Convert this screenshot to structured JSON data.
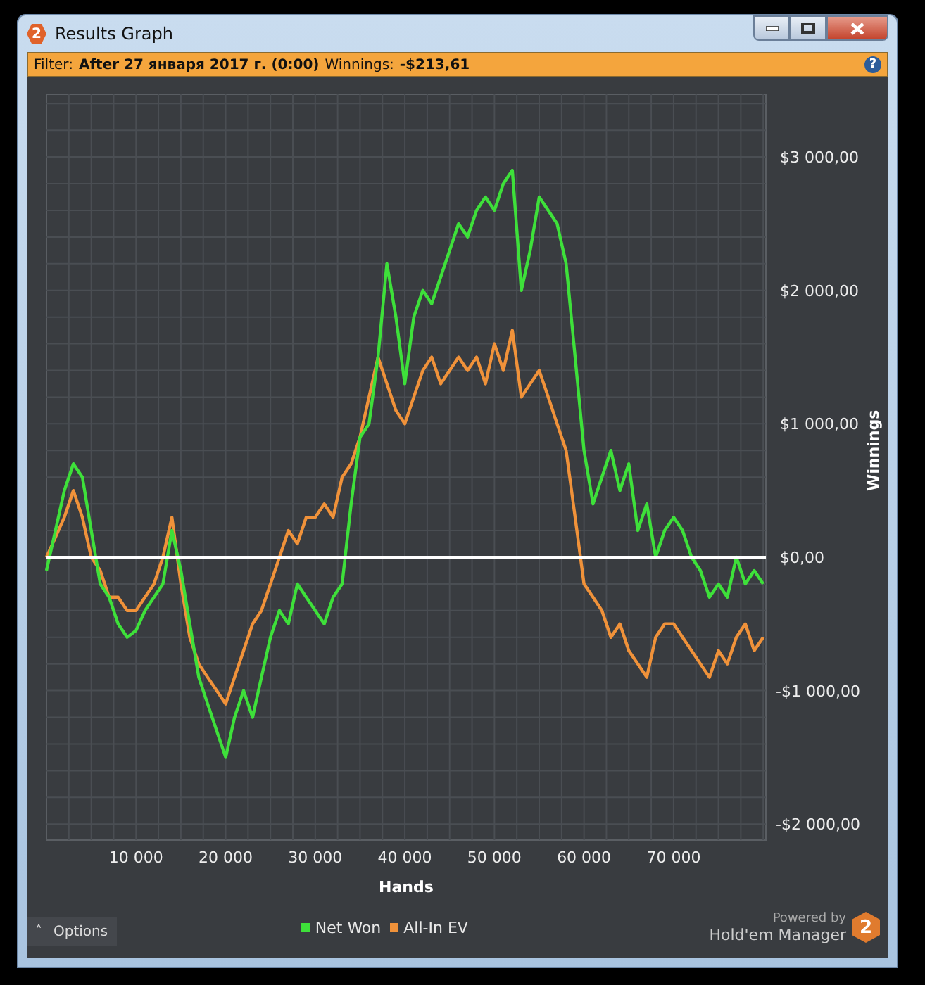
{
  "window": {
    "title": "Results Graph",
    "logo": "2"
  },
  "filter_bar": {
    "filter_label": "Filter:",
    "filter_value": "After 27 января 2017 г. (0:00)",
    "winnings_label": "Winnings:",
    "winnings_value": "-$213,61",
    "help": "?"
  },
  "chart": {
    "chart_data": {
      "type": "line",
      "grid": true,
      "xlabel": "Hands",
      "ylabel": "Winnings",
      "xlim": [
        0,
        80300
      ],
      "ylim": [
        -2120,
        3470
      ],
      "xticks": [
        {
          "value": 10000,
          "label": "10 000"
        },
        {
          "value": 20000,
          "label": "20 000"
        },
        {
          "value": 30000,
          "label": "30 000"
        },
        {
          "value": 40000,
          "label": "40 000"
        },
        {
          "value": 50000,
          "label": "50 000"
        },
        {
          "value": 60000,
          "label": "60 000"
        },
        {
          "value": 70000,
          "label": "70 000"
        }
      ],
      "yticks": [
        {
          "value": 3000,
          "label": "$3 000,00"
        },
        {
          "value": 2000,
          "label": "$2 000,00"
        },
        {
          "value": 1000,
          "label": "$1 000,00"
        },
        {
          "value": 0,
          "label": "$0,00"
        },
        {
          "value": -1000,
          "label": "-$1 000,00"
        },
        {
          "value": -2000,
          "label": "-$2 000,00"
        }
      ],
      "x": [
        0,
        1000,
        2000,
        3000,
        4000,
        5000,
        6000,
        7000,
        8000,
        9000,
        10000,
        11000,
        12000,
        13000,
        14000,
        15000,
        16000,
        17000,
        18000,
        19000,
        20000,
        21000,
        22000,
        23000,
        24000,
        25000,
        26000,
        27000,
        28000,
        29000,
        30000,
        31000,
        32000,
        33000,
        34000,
        35000,
        36000,
        37000,
        38000,
        39000,
        40000,
        41000,
        42000,
        43000,
        44000,
        45000,
        46000,
        47000,
        48000,
        49000,
        50000,
        51000,
        52000,
        53000,
        54000,
        55000,
        56000,
        57000,
        58000,
        59000,
        60000,
        61000,
        62000,
        63000,
        64000,
        65000,
        66000,
        67000,
        68000,
        69000,
        70000,
        71000,
        72000,
        73000,
        74000,
        75000,
        76000,
        77000,
        78000,
        79000,
        80000
      ],
      "series": [
        {
          "name": "All-In EV",
          "color": "#f0923a",
          "values": [
            0,
            150,
            300,
            500,
            300,
            0,
            -100,
            -300,
            -300,
            -400,
            -400,
            -300,
            -200,
            0,
            300,
            -200,
            -600,
            -800,
            -900,
            -1000,
            -1100,
            -900,
            -700,
            -500,
            -400,
            -200,
            0,
            200,
            100,
            300,
            300,
            400,
            300,
            600,
            700,
            900,
            1200,
            1500,
            1300,
            1100,
            1000,
            1200,
            1400,
            1500,
            1300,
            1400,
            1500,
            1400,
            1500,
            1300,
            1600,
            1400,
            1700,
            1200,
            1300,
            1400,
            1200,
            1000,
            800,
            300,
            -200,
            -300,
            -400,
            -600,
            -500,
            -700,
            -800,
            -900,
            -600,
            -500,
            -500,
            -600,
            -700,
            -800,
            -900,
            -700,
            -800,
            -600,
            -500,
            -700,
            -600
          ]
        },
        {
          "name": "Net Won",
          "color": "#3ee03a",
          "values": [
            -100,
            200,
            500,
            700,
            600,
            200,
            -200,
            -300,
            -500,
            -600,
            -550,
            -400,
            -300,
            -200,
            200,
            -100,
            -500,
            -900,
            -1100,
            -1300,
            -1500,
            -1200,
            -1000,
            -1200,
            -900,
            -600,
            -400,
            -500,
            -200,
            -300,
            -400,
            -500,
            -300,
            -200,
            400,
            900,
            1000,
            1500,
            2200,
            1800,
            1300,
            1800,
            2000,
            1900,
            2100,
            2300,
            2500,
            2400,
            2600,
            2700,
            2600,
            2800,
            2900,
            2000,
            2300,
            2700,
            2600,
            2500,
            2200,
            1500,
            800,
            400,
            600,
            800,
            500,
            700,
            200,
            400,
            0,
            200,
            300,
            200,
            0,
            -100,
            -300,
            -200,
            -300,
            0,
            -200,
            -100,
            -200
          ]
        }
      ]
    }
  },
  "footer": {
    "options_button": "Options",
    "options_caret": "˄",
    "powered_by": "Powered by",
    "brand": "Hold'em Manager",
    "brand_logo": "2"
  }
}
